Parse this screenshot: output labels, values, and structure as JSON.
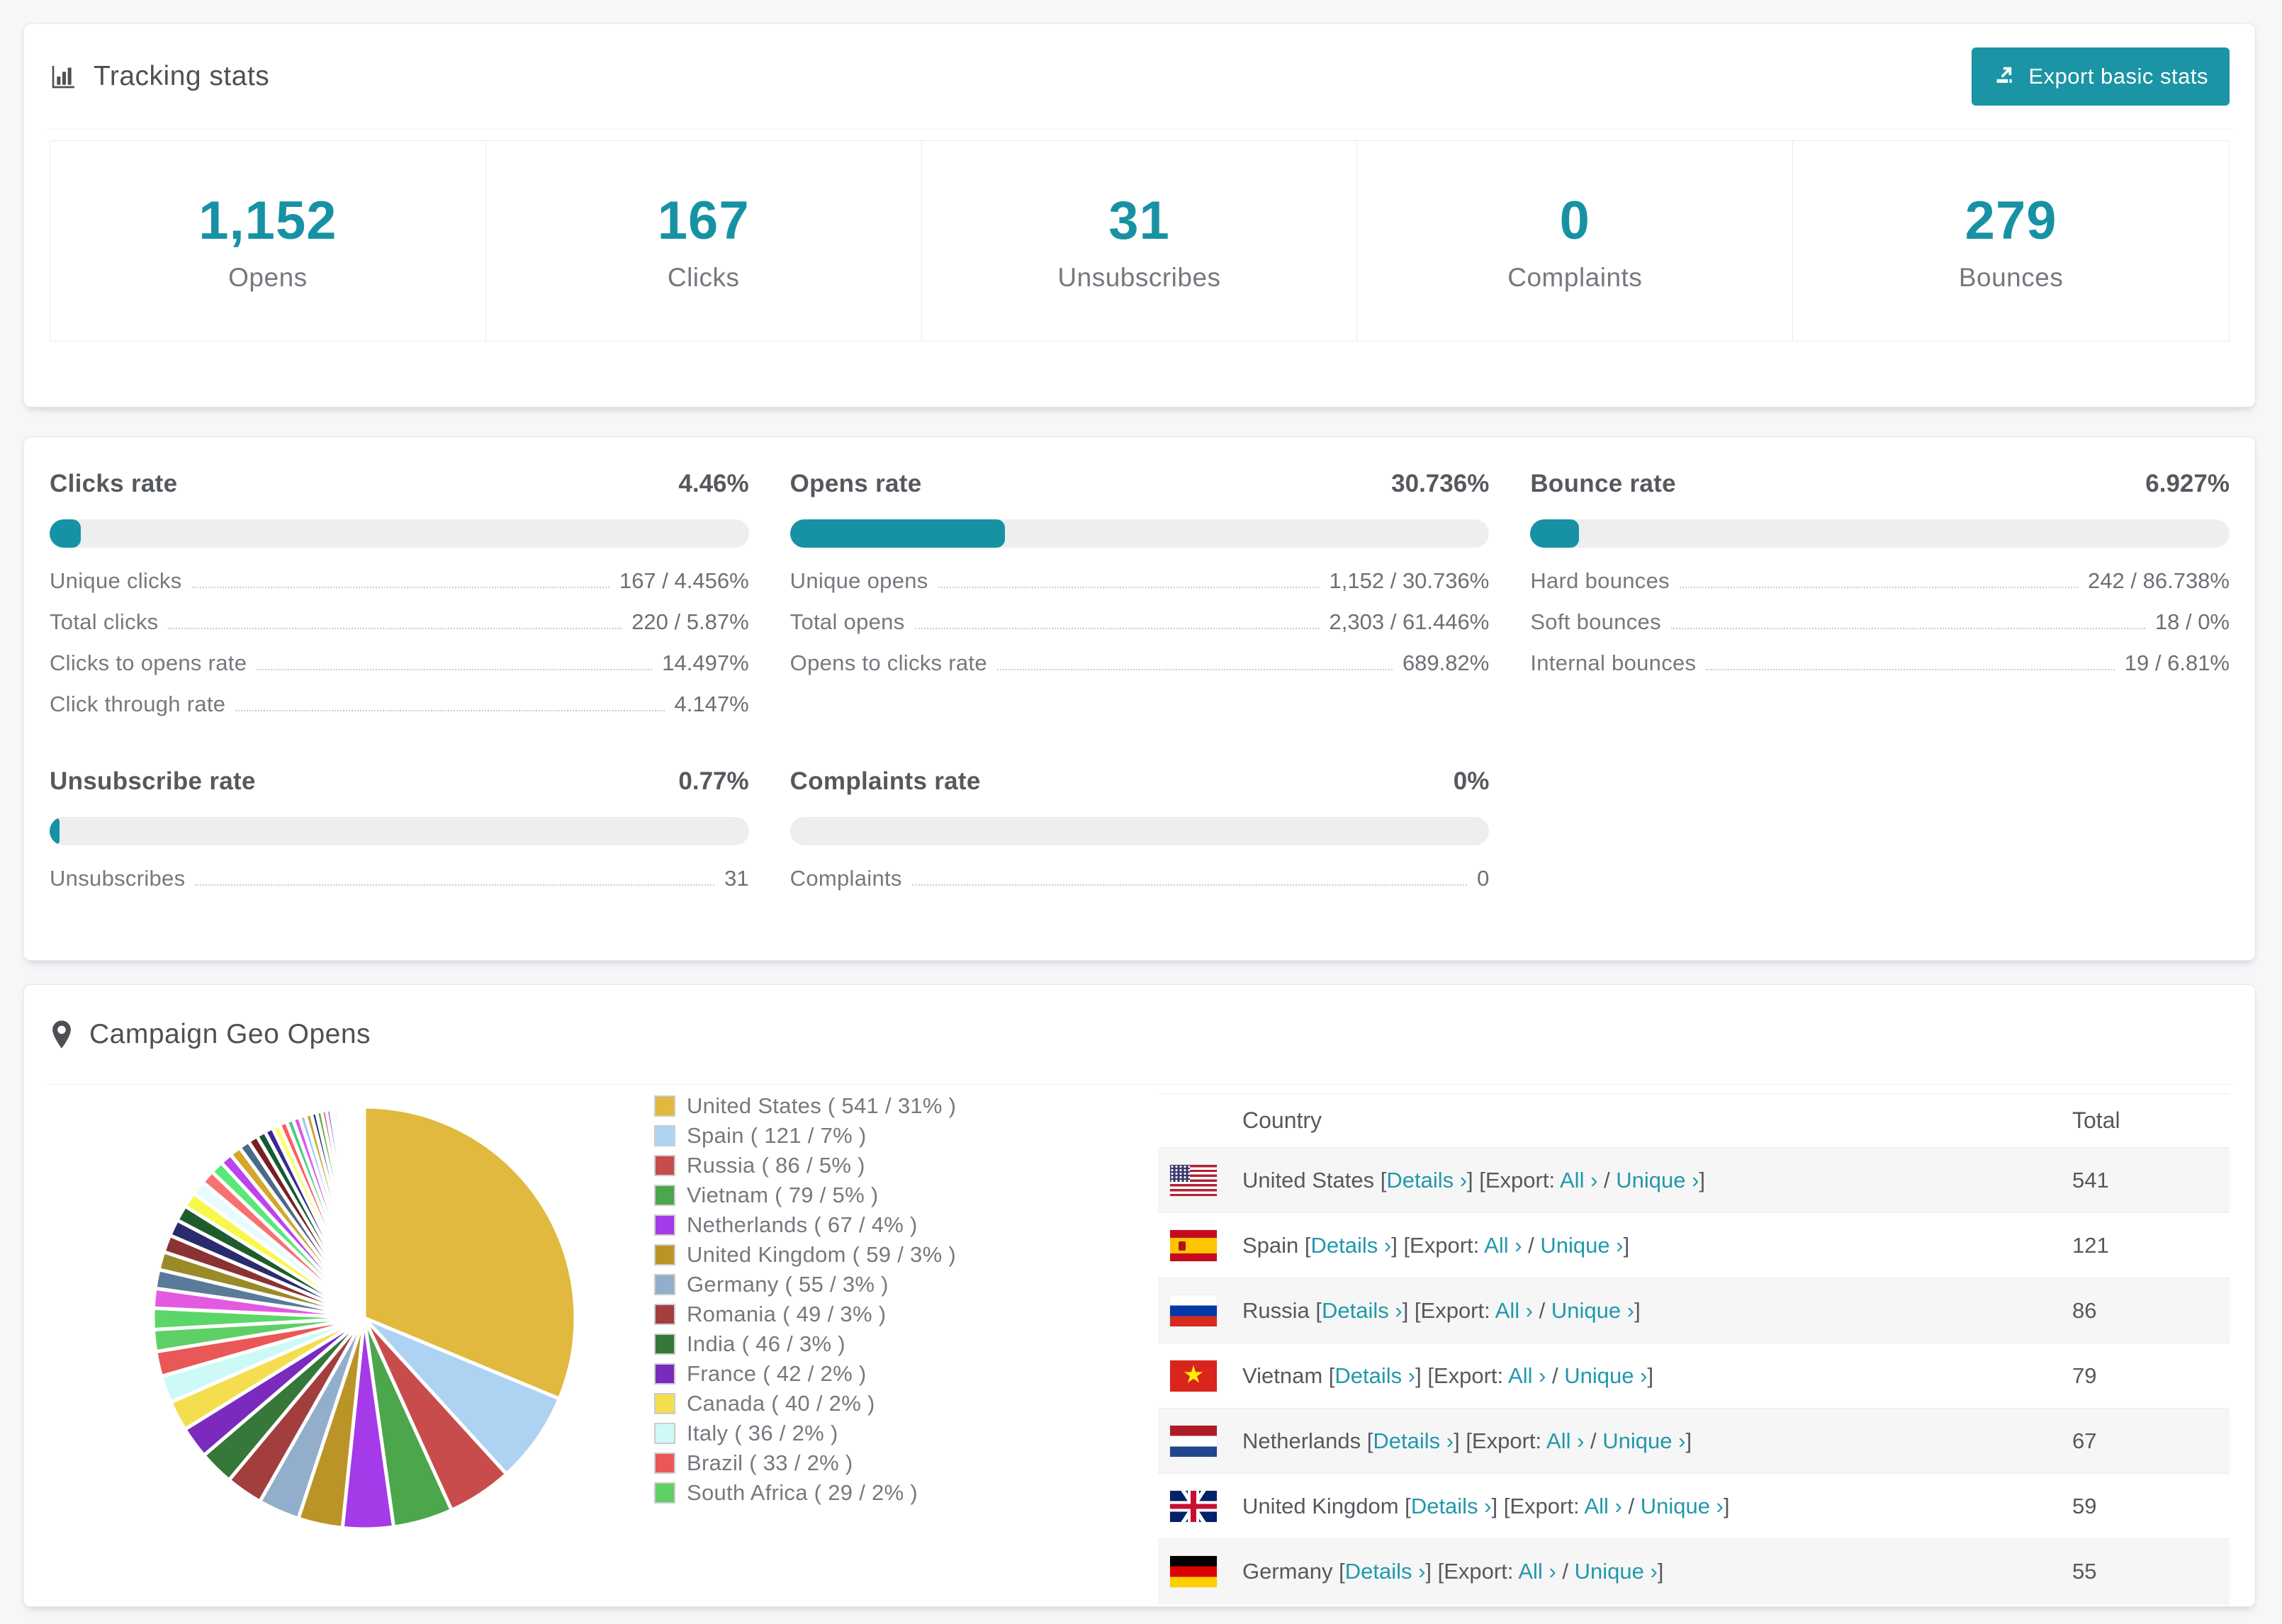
{
  "theme": {
    "accent": "#1792a4",
    "link": "#2298ab",
    "bar_track": "#eceef0",
    "page_bg": "#f6f7f8",
    "stripe_bg": "#f6f6f6"
  },
  "tracking": {
    "title": "Tracking stats",
    "title_icon": "bar-chart-icon",
    "export_label": "Export basic stats",
    "export_icon": "export-arrow-icon",
    "stats": [
      {
        "value": "1,152",
        "label": "Opens"
      },
      {
        "value": "167",
        "label": "Clicks"
      },
      {
        "value": "31",
        "label": "Unsubscribes"
      },
      {
        "value": "0",
        "label": "Complaints"
      },
      {
        "value": "279",
        "label": "Bounces"
      }
    ]
  },
  "rates": {
    "blocks": [
      {
        "title": "Clicks rate",
        "value": "4.46%",
        "pct": 4.46,
        "rows": [
          {
            "label": "Unique clicks",
            "value": "167 / 4.456%"
          },
          {
            "label": "Total clicks",
            "value": "220 / 5.87%"
          },
          {
            "label": "Clicks to opens rate",
            "value": "14.497%"
          },
          {
            "label": "Click through rate",
            "value": "4.147%"
          }
        ]
      },
      {
        "title": "Opens rate",
        "value": "30.736%",
        "pct": 30.736,
        "rows": [
          {
            "label": "Unique opens",
            "value": "1,152 / 30.736%"
          },
          {
            "label": "Total opens",
            "value": "2,303 / 61.446%"
          },
          {
            "label": "Opens to clicks rate",
            "value": "689.82%"
          }
        ]
      },
      {
        "title": "Bounce rate",
        "value": "6.927%",
        "pct": 6.927,
        "rows": [
          {
            "label": "Hard bounces",
            "value": "242 / 86.738%"
          },
          {
            "label": "Soft bounces",
            "value": "18 / 0%"
          },
          {
            "label": "Internal bounces",
            "value": "19 / 6.81%"
          }
        ]
      },
      {
        "title": "Unsubscribe rate",
        "value": "0.77%",
        "pct": 0.77,
        "rows": [
          {
            "label": "Unsubscribes",
            "value": "31"
          }
        ]
      },
      {
        "title": "Complaints rate",
        "value": "0%",
        "pct": 0,
        "rows": [
          {
            "label": "Complaints",
            "value": "0"
          }
        ]
      }
    ]
  },
  "geo": {
    "title": "Campaign Geo Opens",
    "title_icon": "map-pin-icon",
    "table": {
      "col_country": "Country",
      "col_total": "Total",
      "details_label": "Details ›",
      "export_label": "Export:",
      "all_label": "All ›",
      "unique_label": "Unique ›",
      "rows": [
        {
          "country": "United States",
          "flag": "us",
          "total": "541"
        },
        {
          "country": "Spain",
          "flag": "es",
          "total": "121"
        },
        {
          "country": "Russia",
          "flag": "ru",
          "total": "86"
        },
        {
          "country": "Vietnam",
          "flag": "vn",
          "total": "79"
        },
        {
          "country": "Netherlands",
          "flag": "nl",
          "total": "67"
        },
        {
          "country": "United Kingdom",
          "flag": "gb",
          "total": "59"
        },
        {
          "country": "Germany",
          "flag": "de",
          "total": "55"
        }
      ]
    }
  },
  "chart_data": {
    "type": "pie",
    "title": "Campaign Geo Opens",
    "legend_position": "right",
    "start_angle_deg": -90,
    "direction": "clockwise",
    "countries": [
      {
        "label": "United States",
        "value": 541,
        "pct": 31,
        "color": "#e0b93e"
      },
      {
        "label": "Spain",
        "value": 121,
        "pct": 7,
        "color": "#aed3f2"
      },
      {
        "label": "Russia",
        "value": 86,
        "pct": 5,
        "color": "#c94c4c"
      },
      {
        "label": "Vietnam",
        "value": 79,
        "pct": 5,
        "color": "#4ca64c"
      },
      {
        "label": "Netherlands",
        "value": 67,
        "pct": 4,
        "color": "#a43ae8"
      },
      {
        "label": "United Kingdom",
        "value": 59,
        "pct": 3,
        "color": "#bb9427"
      },
      {
        "label": "Germany",
        "value": 55,
        "pct": 3,
        "color": "#92aeca"
      },
      {
        "label": "Romania",
        "value": 49,
        "pct": 3,
        "color": "#a33e3e"
      },
      {
        "label": "India",
        "value": 46,
        "pct": 3,
        "color": "#35783a"
      },
      {
        "label": "France",
        "value": 42,
        "pct": 2,
        "color": "#7a2bbd"
      },
      {
        "label": "Canada",
        "value": 40,
        "pct": 2,
        "color": "#f4de4f"
      },
      {
        "label": "Italy",
        "value": 36,
        "pct": 2,
        "color": "#cdfaf7"
      },
      {
        "label": "Brazil",
        "value": 33,
        "pct": 2,
        "color": "#ea5757"
      },
      {
        "label": "South Africa",
        "value": 29,
        "pct": 2,
        "color": "#5ed066"
      }
    ],
    "others_slices": [
      28,
      26,
      25,
      24,
      23,
      22,
      21,
      20,
      19,
      18,
      17,
      16,
      15,
      14,
      13,
      12,
      11,
      10,
      10,
      9,
      9,
      8,
      8,
      7,
      7,
      6,
      6,
      5,
      5,
      4,
      4,
      4,
      3,
      3,
      3,
      2,
      2,
      2,
      2,
      1,
      1,
      1,
      1,
      1
    ],
    "others_palette": [
      "#5cd668",
      "#e35ae0",
      "#5a7a99",
      "#9a8a28",
      "#8a3333",
      "#2a2a6e",
      "#1e5c2e",
      "#f8f84a",
      "#e8fbff",
      "#f87171",
      "#59e87a",
      "#bb44ee",
      "#d4a62a",
      "#4a6a8a",
      "#7a1f1f",
      "#145a32",
      "#3b2a8e",
      "#ffff66",
      "#ff5c5c",
      "#44cc88",
      "#dd55ee",
      "#99ccf0",
      "#c9a227",
      "#223377",
      "#55aa33",
      "#cc3344",
      "#8855dd",
      "#eeee44",
      "#66ddee",
      "#ee7755",
      "#33bb55",
      "#aa44bb",
      "#7799bb",
      "#aa8822",
      "#662222",
      "#224488"
    ]
  }
}
